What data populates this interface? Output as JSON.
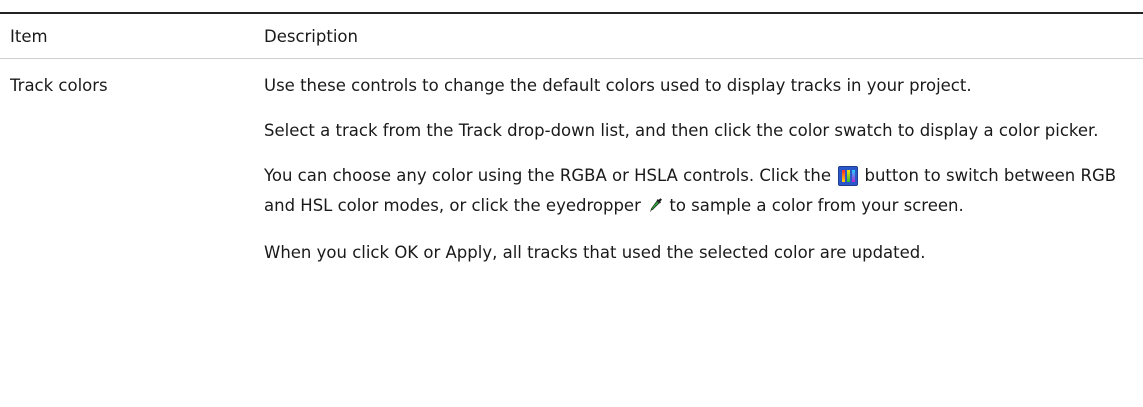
{
  "table": {
    "headers": {
      "item": "Item",
      "description": "Description"
    },
    "rows": [
      {
        "item": "Track colors",
        "p1": "Use these controls to change the default colors used to display tracks in your project.",
        "p2": {
          "pre": "Select a track from the ",
          "term": "Track",
          "post": " drop-down list, and then click the color swatch to display a color picker."
        },
        "p3": {
          "pre": "You can choose any color using the RGBA or HSLA controls. Click the ",
          "mid": " button to switch between RGB and HSL color modes, or click the eyedropper ",
          "post": " to sample a color from your screen.",
          "icon_button": "rgb-hsl-toggle-icon",
          "icon_eyedropper": "eyedropper-icon"
        },
        "p4": {
          "pre": "When you click ",
          "term1": "OK",
          "mid": " or ",
          "term2": "Apply",
          "post": ", all tracks that used the selected color are updated."
        }
      }
    ]
  },
  "colors": {
    "rule": "#222222",
    "divider": "#cfcfcf",
    "text": "#1a1a1a",
    "icon_blue": "#2b56c8"
  }
}
